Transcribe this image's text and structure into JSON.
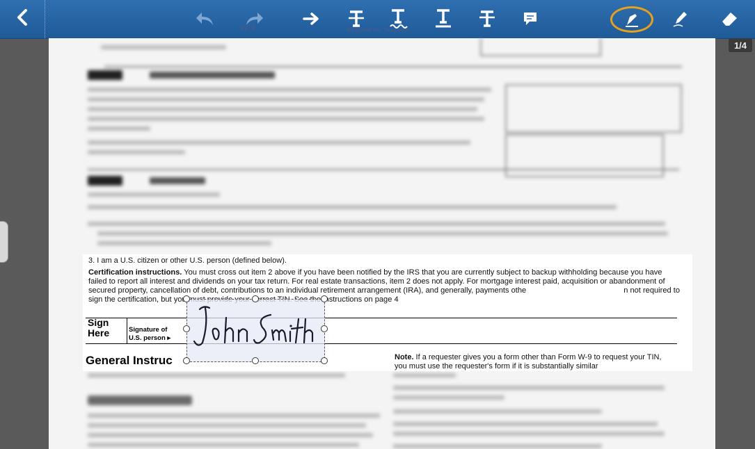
{
  "toolbar": {
    "tools": [
      {
        "name": "undo-icon"
      },
      {
        "name": "redo-icon"
      },
      {
        "name": "arrow-right-icon"
      },
      {
        "name": "strikethrough-icon"
      },
      {
        "name": "squiggly-underline-icon"
      },
      {
        "name": "underline-icon"
      },
      {
        "name": "strikeout-icon"
      },
      {
        "name": "comment-icon"
      },
      {
        "name": "signature-icon",
        "active": true
      },
      {
        "name": "pen-icon"
      },
      {
        "name": "eraser-icon"
      }
    ],
    "accent_color": "#e8a21a",
    "bar_color": "#2a66a6"
  },
  "page_indicator": "1/4",
  "document": {
    "ghost_header_left": "W-9",
    "ghost_header_mid": "Request for Taxpayer",
    "cert_item_3": "3. I am a U.S. citizen or other U.S. person (defined below).",
    "cert_heading": "Certification instructions.",
    "cert_text_1": " You must cross out item 2 above if you have been notified by the IRS that you are currently subject to backup withholding because you have failed to report all interest and dividends on your tax return. For real estate transactions, item 2 does not apply. For mortgage interest paid, acquisition or abandonment of secured property, cancellation of debt, contributions to an individual retirement arrangement (IRA), and generally, payments othe",
    "cert_text_2": "n not required to sign the certification, but you must provide your correct TIN. See the instructions on page 4",
    "sign_label": "Sign Here",
    "signature_of_label": "Signature of",
    "us_person_label": "U.S. person ▸",
    "general_heading": "General Instruc",
    "note_heading": "Note.",
    "note_text": " If a requester gives you a form other than Form W-9 to request your TIN, you must use the requester's form if it is substantially similar",
    "signature_text": "John Smith"
  }
}
